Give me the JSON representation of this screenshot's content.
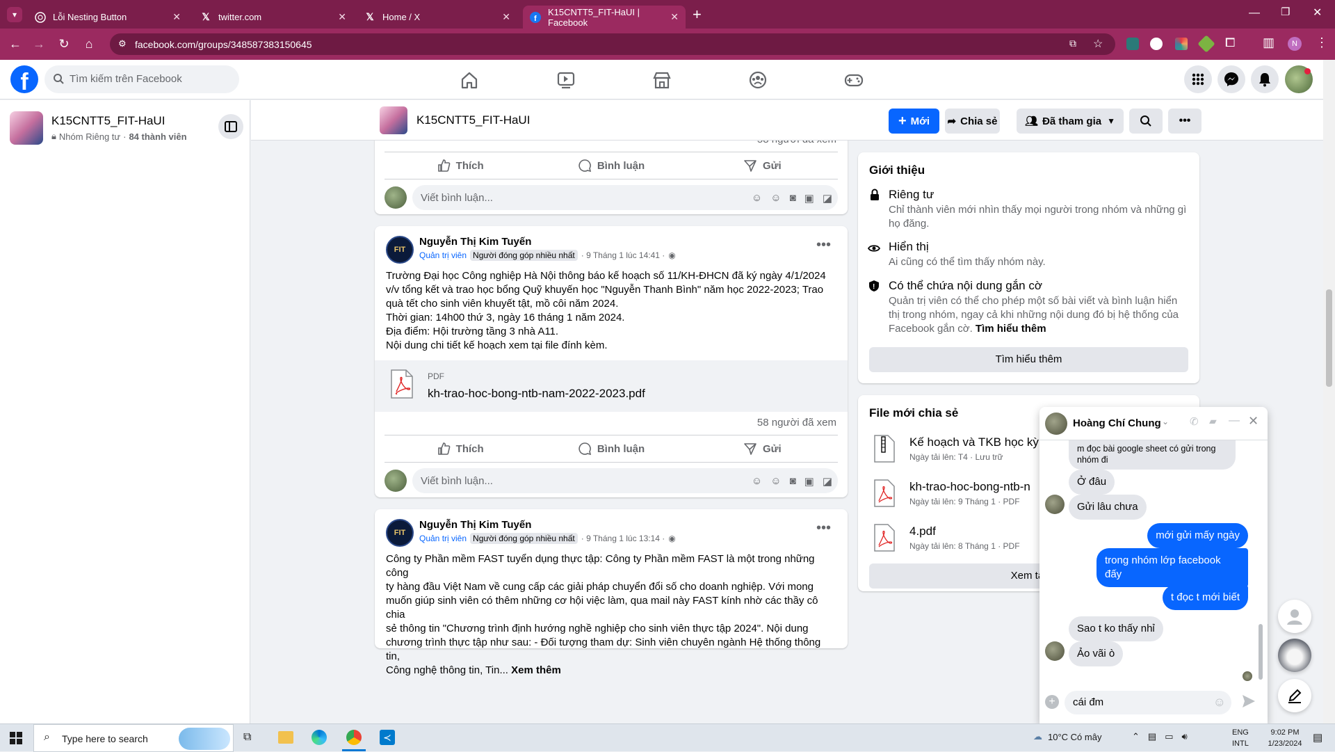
{
  "browser": {
    "tabs": [
      {
        "label": "Lỗi Nesting Button",
        "icon": "chatgpt-icon"
      },
      {
        "label": "twitter.com",
        "icon": "x-icon"
      },
      {
        "label": "Home / X",
        "icon": "x-icon"
      },
      {
        "label": "K15CNTT5_FIT-HaUI | Facebook",
        "icon": "facebook-icon"
      }
    ],
    "url": "facebook.com/groups/348587383150645",
    "profile_initial": "N"
  },
  "fb": {
    "search_placeholder": "Tìm kiếm trên Facebook"
  },
  "sidebar": {
    "group_name": "K15CNTT5_FIT-HaUI",
    "group_privacy": "Nhóm Riêng tư",
    "member_count": "84 thành viên"
  },
  "group_header": {
    "title": "K15CNTT5_FIT-HaUI",
    "new_button": "Mới",
    "share_button": "Chia sẻ",
    "joined_button": "Đã tham gia"
  },
  "post_top": {
    "views": "58 người đã xem",
    "like": "Thích",
    "comment": "Bình luận",
    "send": "Gửi",
    "comment_placeholder": "Viết bình luận..."
  },
  "post1": {
    "author": "Nguyễn Thị Kim Tuyến",
    "role": "Quản trị viên",
    "badge": "Người đóng góp nhiều nhất",
    "time": "· 9 Tháng 1 lúc 14:41 ·",
    "text_lines": [
      "Trường Đại học Công nghiệp Hà Nội thông báo kế hoạch số 11/KH-ĐHCN đã ký ngày 4/1/2024",
      "v/v tổng kết và trao học bổng Quỹ khuyến học \"Nguyễn Thanh Bình\" năm học 2022-2023; Trao",
      "quà tết cho sinh viên khuyết tật, mồ côi năm 2024.",
      "Thời gian: 14h00 thứ 3, ngày 16 tháng 1 năm 2024.",
      "Địa điểm: Hội trường tầng 3 nhà A11.",
      "Nội dung chi tiết kế hoạch xem tại file đính kèm."
    ],
    "file_type": "PDF",
    "file_name": "kh-trao-hoc-bong-ntb-nam-2022-2023.pdf",
    "views": "58 người đã xem",
    "like": "Thích",
    "comment": "Bình luận",
    "send": "Gửi",
    "comment_placeholder": "Viết bình luận..."
  },
  "post2": {
    "author": "Nguyễn Thị Kim Tuyến",
    "role": "Quản trị viên",
    "badge": "Người đóng góp nhiều nhất",
    "time": "· 9 Tháng 1 lúc 13:14 ·",
    "text_lines": [
      "Công ty Phần mềm FAST tuyển dụng thực tập: Công ty Phần mềm FAST là một trong những công",
      "ty hàng đầu Việt Nam về cung cấp các giải pháp chuyển đổi số cho doanh nghiệp. Với mong",
      "muốn giúp sinh viên có thêm những cơ hội việc làm, qua mail này FAST kính nhờ các thầy cô chia",
      "sẻ thông tin \"Chương trình định hướng nghề nghiệp cho sinh viên thực tập 2024\". Nội dung",
      "chương trình thực tập như sau: - Đối tượng tham dự: Sinh viên chuyên ngành Hệ thống thông tin,"
    ],
    "last_line": "Công nghệ thông tin, Tin...",
    "see_more": "Xem thêm"
  },
  "about": {
    "heading": "Giới thiệu",
    "items": [
      {
        "title": "Riêng tư",
        "desc": "Chỉ thành viên mới nhìn thấy mọi người trong nhóm và những gì họ đăng.",
        "icon": "lock-icon"
      },
      {
        "title": "Hiển thị",
        "desc": "Ai cũng có thể tìm thấy nhóm này.",
        "icon": "eye-icon"
      },
      {
        "title": "Có thể chứa nội dung gắn cờ",
        "desc": "Quản trị viên có thể cho phép một số bài viết và bình luận hiển thị trong nhóm, ngay cả khi những nội dung đó bị hệ thống của Facebook gắn cờ.",
        "link": "Tìm hiểu thêm",
        "icon": "shield-icon"
      }
    ],
    "button": "Tìm hiểu thêm"
  },
  "files": {
    "heading": "File mới chia sẻ",
    "items": [
      {
        "name": "Kế hoạch và TKB học kỳ",
        "meta": "Ngày tải lên: T4 · Lưu trữ"
      },
      {
        "name": "kh-trao-hoc-bong-ntb-n",
        "meta": "Ngày tải lên: 9 Tháng 1 · PDF"
      },
      {
        "name": "4.pdf",
        "meta": "Ngày tải lên: 8 Tháng 1 · PDF"
      }
    ],
    "see_all": "Xem tất"
  },
  "chat": {
    "contact": "Hoàng Chí Chung",
    "messages": [
      {
        "from": "them",
        "text": "m đọc bài google sheet có gửi trong nhóm đi"
      },
      {
        "from": "them",
        "text": "Ở đâu"
      },
      {
        "from": "them",
        "text": "Gửi lâu chưa"
      },
      {
        "from": "me",
        "text": "mới gửi mấy ngày"
      },
      {
        "from": "me",
        "text": "trong nhóm lớp facebook đấy"
      },
      {
        "from": "me",
        "text": "t đọc t mới biết"
      },
      {
        "from": "them",
        "text": "Sao t ko thấy nhỉ"
      },
      {
        "from": "them",
        "text": "Ảo vãi ò"
      }
    ],
    "input_value": "cái đm"
  },
  "taskbar": {
    "search_placeholder": "Type here to search",
    "weather": "10°C  Có mây",
    "lang1": "ENG",
    "lang2": "INTL",
    "time": "9:02 PM",
    "date": "1/23/2024"
  },
  "colors": {
    "chrome_tab_bg": "#7b1e4b",
    "chrome_toolbar": "#9b2a60",
    "fb_blue": "#0866ff",
    "fb_bg": "#f0f2f5"
  }
}
